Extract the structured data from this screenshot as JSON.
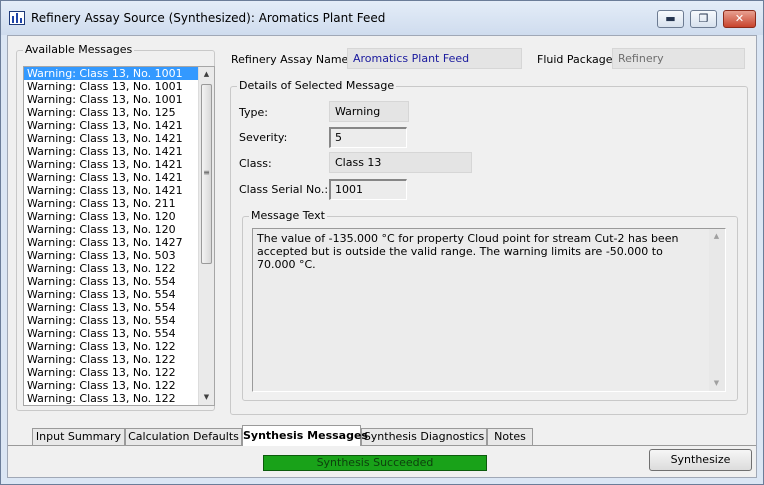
{
  "window": {
    "title": "Refinery Assay Source (Synthesized): Aromatics Plant Feed",
    "controls": {
      "minimize": "▬",
      "restore": "❐",
      "close": "✕"
    }
  },
  "available_messages": {
    "label": "Available Messages",
    "items": [
      "Warning: Class 13, No. 1001",
      "Warning: Class 13, No. 1001",
      "Warning: Class 13, No. 1001",
      "Warning: Class 13, No. 125",
      "Warning: Class 13, No. 1421",
      "Warning: Class 13, No. 1421",
      "Warning: Class 13, No. 1421",
      "Warning: Class 13, No. 1421",
      "Warning: Class 13, No. 1421",
      "Warning: Class 13, No. 1421",
      "Warning: Class 13, No. 211",
      "Warning: Class 13, No. 120",
      "Warning: Class 13, No. 120",
      "Warning: Class 13, No. 1427",
      "Warning: Class 13, No. 503",
      "Warning: Class 13, No. 122",
      "Warning: Class 13, No. 554",
      "Warning: Class 13, No. 554",
      "Warning: Class 13, No. 554",
      "Warning: Class 13, No. 554",
      "Warning: Class 13, No. 554",
      "Warning: Class 13, No. 122",
      "Warning: Class 13, No. 122",
      "Warning: Class 13, No. 122",
      "Warning: Class 13, No. 122",
      "Warning: Class 13, No. 122"
    ],
    "selected_index": 0
  },
  "assay": {
    "name_label": "Refinery Assay Name:",
    "name_value": "Aromatics Plant Feed",
    "fluid_package_label": "Fluid Package:",
    "fluid_package_value": "Refinery"
  },
  "details": {
    "label": "Details of Selected Message",
    "type_label": "Type:",
    "type_value": "Warning",
    "severity_label": "Severity:",
    "severity_value": "5",
    "class_label": "Class:",
    "class_value": "Class 13",
    "serial_label": "Class Serial No.:",
    "serial_value": "1001",
    "message_text_label": "Message Text",
    "message_text": "The value of -135.000 °C for property Cloud point for stream Cut-2 has been accepted but is outside the valid range. The warning limits are -50.000 to 70.000 °C."
  },
  "tabs": [
    {
      "label": "Input Summary",
      "active": false
    },
    {
      "label": "Calculation Defaults",
      "active": false
    },
    {
      "label": "Synthesis Messages",
      "active": true
    },
    {
      "label": "Synthesis Diagnostics",
      "active": false
    },
    {
      "label": "Notes",
      "active": false
    }
  ],
  "status": {
    "text": "Synthesis Succeeded",
    "color": "#19a219"
  },
  "actions": {
    "synthesize": "Synthesize"
  },
  "icons": {
    "app": "chart-bars-icon",
    "scroll_up": "triangle-up-icon",
    "scroll_down": "triangle-down-icon",
    "grip": "grip-lines-icon"
  }
}
